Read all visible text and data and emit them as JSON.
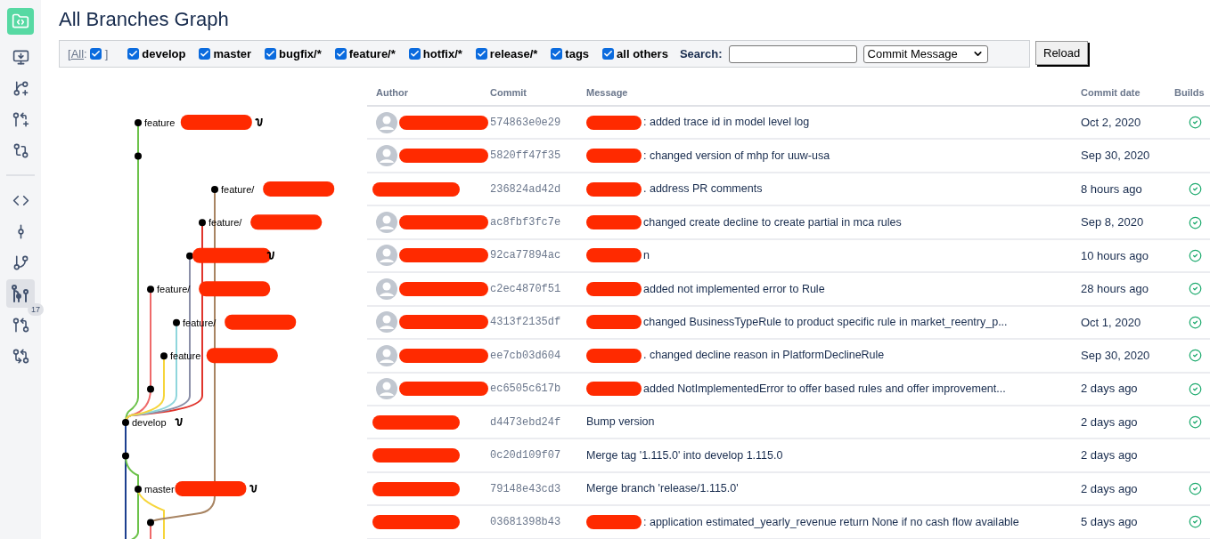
{
  "sidebar": {
    "items": [
      {
        "kind": "logo"
      },
      {
        "kind": "download"
      },
      {
        "kind": "branch-plus"
      },
      {
        "kind": "pr-plus"
      },
      {
        "kind": "compare-plus"
      },
      {
        "kind": "divider"
      },
      {
        "kind": "code"
      },
      {
        "kind": "commit"
      },
      {
        "kind": "branch"
      },
      {
        "kind": "graph",
        "selected": true
      },
      {
        "kind": "pr",
        "badge": "17"
      },
      {
        "kind": "compare"
      }
    ]
  },
  "title": "All Branches Graph",
  "filters": {
    "all": {
      "open": "[",
      "label": "All",
      "separator": ":",
      "close": "]",
      "checked": true
    },
    "items": [
      {
        "label": "develop",
        "checked": true
      },
      {
        "label": "master",
        "checked": true
      },
      {
        "label": "bugfix/*",
        "checked": true
      },
      {
        "label": "feature/*",
        "checked": true
      },
      {
        "label": "hotfix/*",
        "checked": true
      },
      {
        "label": "release/*",
        "checked": true
      },
      {
        "label": "tags",
        "checked": true
      },
      {
        "label": "all others",
        "checked": true
      }
    ],
    "search_label": "Search:",
    "search_by": "Commit Message",
    "reload": "Reload"
  },
  "graph": {
    "nodes": [
      {
        "label": "feature",
        "redacted": true,
        "tag": true
      },
      {
        "redacted": false,
        "tag": false
      },
      {
        "label": "feature/",
        "redacted": true,
        "tag": false
      },
      {
        "label": "feature/",
        "redacted": true,
        "tag": false
      },
      {
        "redacted": true,
        "tag": true
      },
      {
        "label": "feature/",
        "redacted": true,
        "tag": false
      },
      {
        "label": "feature/",
        "redacted": true,
        "tag": false
      },
      {
        "label": "feature",
        "redacted": true,
        "tag": false
      },
      {
        "redacted": false,
        "tag": false
      },
      {
        "label": "develop",
        "redacted": false,
        "tag": true
      },
      {
        "redacted": false,
        "tag": false
      },
      {
        "label": "master",
        "redacted": true,
        "tag": true
      },
      {
        "redacted": false,
        "tag": false
      }
    ]
  },
  "table": {
    "columns": [
      "Author",
      "Commit",
      "Message",
      "Commit date",
      "Builds"
    ],
    "rows": [
      {
        "avatar": true,
        "commit": "574863e0e29",
        "message_redacted": true,
        "message": ": added trace id in model level log",
        "date": "Oct 2, 2020",
        "build_passed": true
      },
      {
        "avatar": true,
        "commit": "5820ff47f35",
        "message_redacted": true,
        "message": ": changed version of mhp for uuw-usa",
        "date": "Sep 30, 2020",
        "build_passed": false
      },
      {
        "avatar": false,
        "commit": "236824ad42d",
        "message_redacted": true,
        "message": ". address PR comments",
        "date": "8 hours ago",
        "build_passed": true
      },
      {
        "avatar": true,
        "commit": "ac8fbf3fc7e",
        "message_redacted": true,
        "message": "changed create decline to create partial in mca rules",
        "date": "Sep 8, 2020",
        "build_passed": true
      },
      {
        "avatar": true,
        "commit": "92ca77894ac",
        "message_redacted": true,
        "message": "n",
        "date": "10 hours ago",
        "build_passed": true
      },
      {
        "avatar": true,
        "commit": "c2ec4870f51",
        "message_redacted": true,
        "message": "added not implemented error to Rule",
        "date": "28 hours ago",
        "build_passed": true
      },
      {
        "avatar": true,
        "commit": "4313f2135df",
        "message_redacted": true,
        "message": "changed BusinessTypeRule to product specific rule in market_reentry_p...",
        "date": "Oct 1, 2020",
        "build_passed": true
      },
      {
        "avatar": true,
        "commit": "ee7cb03d604",
        "message_redacted": true,
        "message": ". changed decline reason in PlatformDeclineRule",
        "date": "Sep 30, 2020",
        "build_passed": true
      },
      {
        "avatar": true,
        "commit": "ec6505c617b",
        "message_redacted": true,
        "message": "added NotImplementedError to offer based rules and offer improvement...",
        "date": "2 days ago",
        "build_passed": true
      },
      {
        "avatar": false,
        "commit": "d4473ebd24f",
        "message_redacted": false,
        "message": "Bump version",
        "date": "2 days ago",
        "build_passed": true
      },
      {
        "avatar": false,
        "commit": "0c20d109f07",
        "message_redacted": false,
        "message": "Merge tag '1.115.0' into develop 1.115.0",
        "date": "2 days ago",
        "build_passed": false
      },
      {
        "avatar": false,
        "commit": "79148e43cd3",
        "message_redacted": false,
        "message": "Merge branch 'release/1.115.0'",
        "date": "2 days ago",
        "build_passed": true
      },
      {
        "avatar": false,
        "commit": "03681398b43",
        "message_redacted": true,
        "message": ": application estimated_yearly_revenue return None if no cash flow available",
        "date": "5 days ago",
        "build_passed": true
      }
    ]
  }
}
